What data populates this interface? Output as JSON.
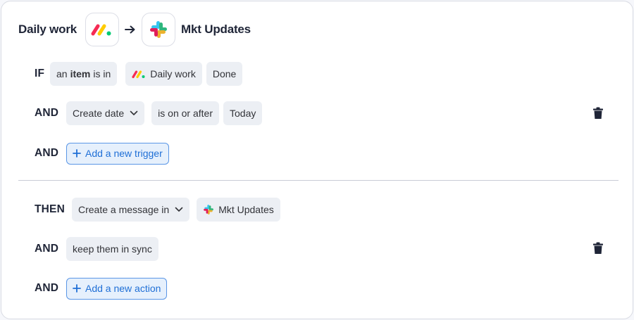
{
  "header": {
    "source_name": "Daily work",
    "source_icon": "monday-logo-icon",
    "arrow_icon": "arrow-right-icon",
    "target_icon": "slack-logo-icon",
    "target_name": "Mkt Updates"
  },
  "trigger": {
    "if_keyword": "IF",
    "if_condition": {
      "pre": "an",
      "bold": "item",
      "post": "is in"
    },
    "if_board": "Daily work",
    "if_group": "Done",
    "and_keyword": "AND",
    "date_field": "Create date",
    "date_operator": "is on or after",
    "date_value": "Today",
    "add_trigger_label": "Add a new trigger"
  },
  "action": {
    "then_keyword": "THEN",
    "action_select": "Create a message in",
    "channel": "Mkt Updates",
    "and_keyword": "AND",
    "sync_option": "keep them in sync",
    "add_action_label": "Add a new action"
  },
  "colors": {
    "accent_blue": "#1f6fd6",
    "chip_bg": "#eceff4",
    "text_dark": "#1f2537"
  }
}
